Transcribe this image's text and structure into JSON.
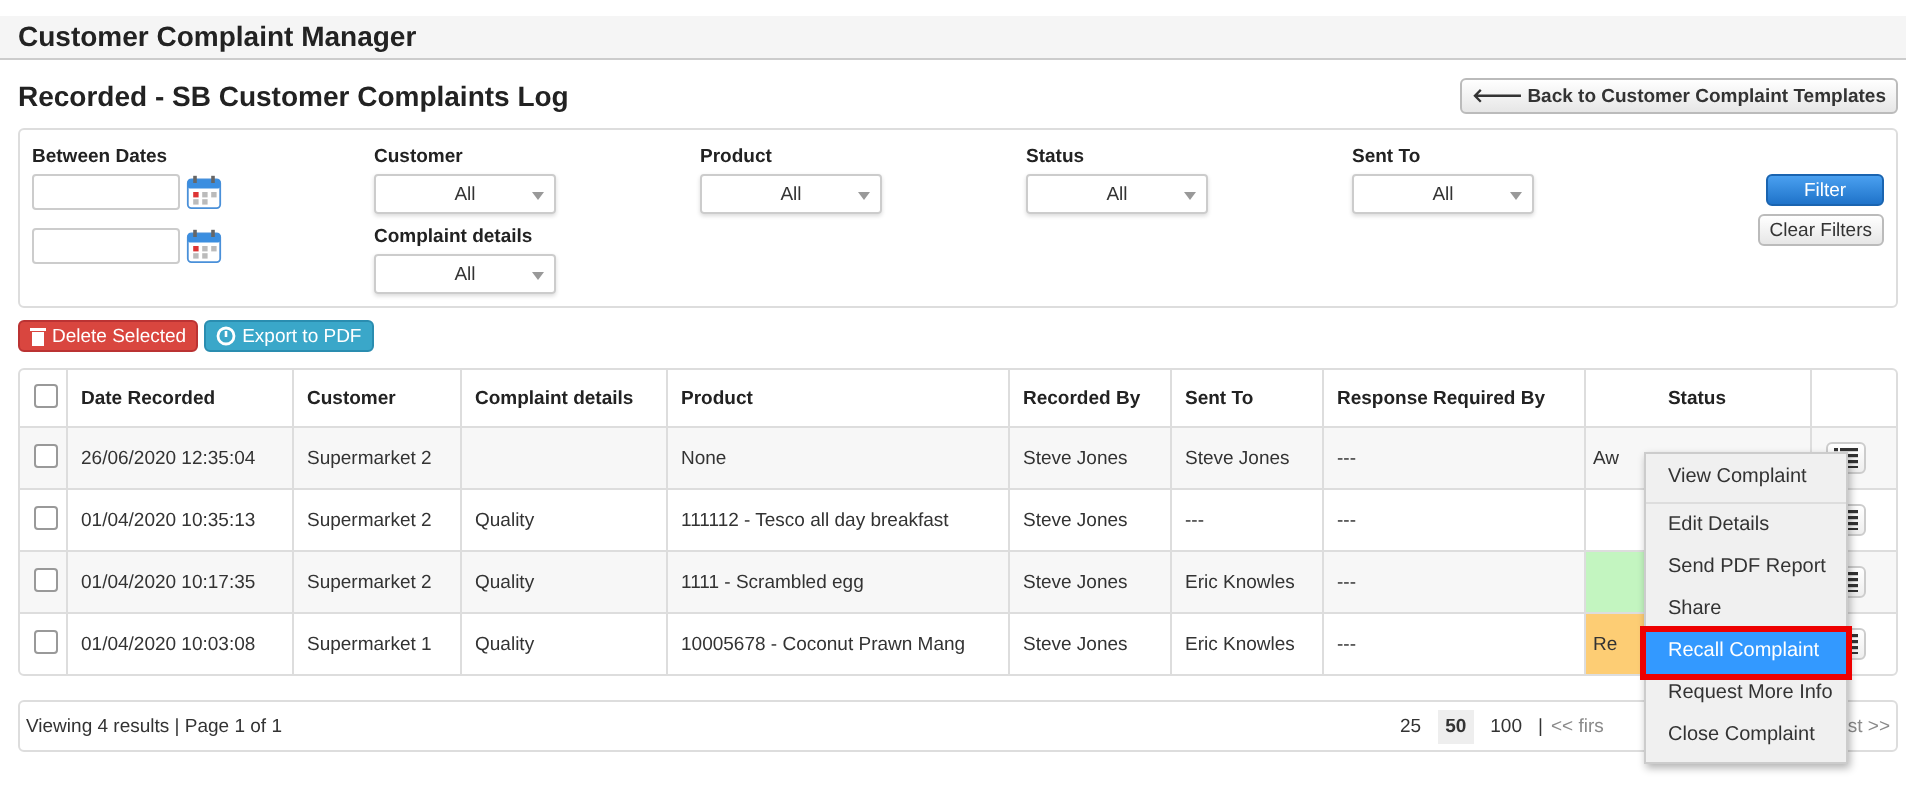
{
  "app_title": "Customer Complaint Manager",
  "page_title": "Recorded - SB Customer Complaints Log",
  "back_button": {
    "icon": "🡐",
    "label": "Back to Customer Complaint Templates"
  },
  "filters": {
    "dates": {
      "label": "Between Dates",
      "fields": [
        {
          "kind": "date"
        },
        {
          "kind": "date"
        }
      ]
    },
    "selects": [
      {
        "label": "Customer",
        "value": "All"
      },
      {
        "label": "Product",
        "value": "All"
      },
      {
        "label": "Status",
        "value": "All"
      },
      {
        "label": "Sent To",
        "value": "All"
      }
    ],
    "complaint_details": {
      "label": "Complaint details",
      "value": "All"
    },
    "filter_button": "Filter",
    "clear_button": "Clear Filters"
  },
  "actions": [
    {
      "kind": "danger",
      "label": "Delete Selected"
    },
    {
      "kind": "info",
      "label": "Export to PDF"
    }
  ],
  "table": {
    "select_all": {
      "checked": false
    },
    "columns": [
      "Date Recorded",
      "Customer",
      "Complaint details",
      "Product",
      "Recorded By",
      "Sent To",
      "Response Required By",
      "Status"
    ],
    "rows": [
      {
        "checked": false,
        "cells": [
          "26/06/2020 12:35:04",
          "Supermarket 2",
          "",
          "None",
          "Steve Jones",
          "Steve Jones",
          "---"
        ],
        "status": {
          "text": "Aw"
        }
      },
      {
        "checked": false,
        "cells": [
          "01/04/2020 10:35:13",
          "Supermarket 2",
          "Quality",
          "111112 - Tesco all day breakfast",
          "Steve Jones",
          "---",
          "---"
        ],
        "status": {}
      },
      {
        "checked": false,
        "cells": [
          "01/04/2020 10:17:35",
          "Supermarket 2",
          "Quality",
          "1111 - Scrambled egg",
          "Steve Jones",
          "Eric Knowles",
          "---"
        ],
        "status": {
          "color": "#c3f5c0"
        }
      },
      {
        "checked": false,
        "cells": [
          "01/04/2020 10:03:08",
          "Supermarket 1",
          "Quality",
          "10005678 - Coconut Prawn Mang",
          "Steve Jones",
          "Eric Knowles",
          "---"
        ],
        "status": {
          "text": "Re",
          "color": "#fdcd74"
        }
      }
    ]
  },
  "footer": {
    "summary": "Viewing 4 results | Page 1 of 1",
    "page_sizes": [
      {
        "label": "25",
        "selected": false
      },
      {
        "label": "50",
        "selected": true
      },
      {
        "label": "100",
        "selected": false
      }
    ],
    "separator": "|",
    "first": "<< firs",
    "last": "st >>"
  },
  "context_menu": [
    {
      "kind": "item",
      "label": "View Complaint",
      "selected": false,
      "outlined": false
    },
    {
      "kind": "divider"
    },
    {
      "kind": "item",
      "label": "Edit Details",
      "selected": false,
      "outlined": false
    },
    {
      "kind": "item",
      "label": "Send PDF Report",
      "selected": false,
      "outlined": false
    },
    {
      "kind": "item",
      "label": "Share",
      "selected": false,
      "outlined": false
    },
    {
      "kind": "item",
      "label": "Recall Complaint",
      "selected": true,
      "outlined": true
    },
    {
      "kind": "item",
      "label": "Request More Info",
      "selected": false,
      "outlined": false
    },
    {
      "kind": "item",
      "label": "Close Complaint",
      "selected": false,
      "outlined": false
    }
  ]
}
